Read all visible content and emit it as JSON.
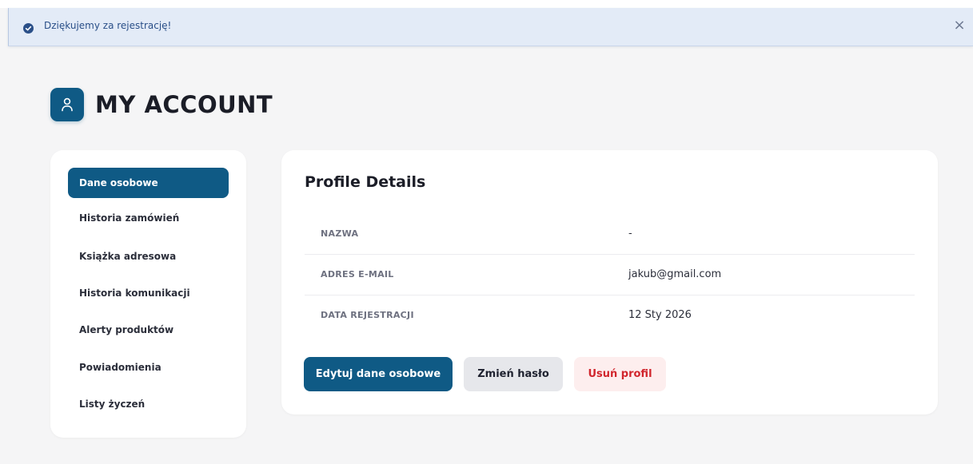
{
  "alert": {
    "message": "Dziękujemy za rejestrację!",
    "close_symbol": "×",
    "icon": "check-circle-icon",
    "color": "#2a4f88"
  },
  "header": {
    "title": "MY ACCOUNT",
    "icon": "user-icon"
  },
  "sidebar": {
    "items": [
      {
        "label": "Dane osobowe",
        "active": true
      },
      {
        "label": "Historia zamówień",
        "active": false
      },
      {
        "label": "Książka adresowa",
        "active": false
      },
      {
        "label": "Historia komunikacji",
        "active": false
      },
      {
        "label": "Alerty produktów",
        "active": false
      },
      {
        "label": "Powiadomienia",
        "active": false
      },
      {
        "label": "Listy życzeń",
        "active": false
      }
    ]
  },
  "profile": {
    "title": "Profile Details",
    "rows": [
      {
        "label": "NAZWA",
        "value": "-"
      },
      {
        "label": "ADRES E-MAIL",
        "value": "jakub@gmail.com"
      },
      {
        "label": "DATA REJESTRACJI",
        "value": "12 Sty 2026"
      }
    ]
  },
  "actions": {
    "edit_label": "Edytuj dane osobowe",
    "password_label": "Zmień hasło",
    "delete_label": "Usuń profil"
  },
  "colors": {
    "accent": "#0f5a85",
    "danger": "#d1262d",
    "danger_bg": "#fdeeee",
    "alert_bg": "#e3ebf7"
  }
}
